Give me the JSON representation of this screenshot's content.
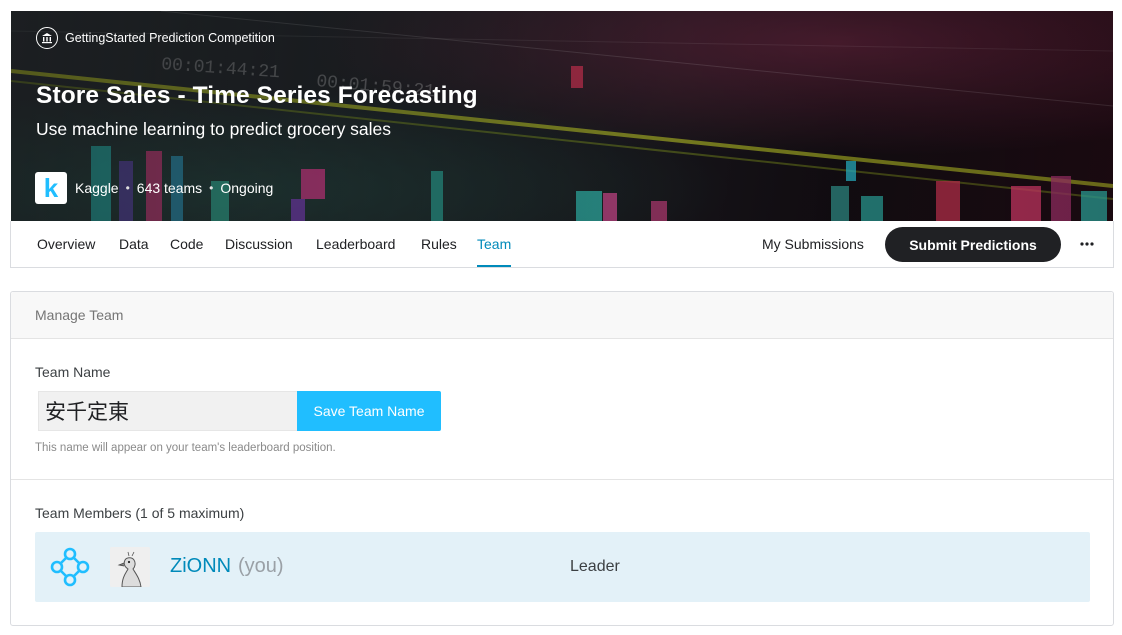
{
  "hero": {
    "badge": "GettingStarted Prediction Competition",
    "badge_icon": "institution-icon",
    "title": "Store Sales - Time Series Forecasting",
    "subtitle": "Use machine learning to predict grocery sales",
    "host": "Kaggle",
    "teams": "643 teams",
    "status": "Ongoing",
    "logo_letter": "k",
    "accent_color": "#20beff"
  },
  "nav": {
    "tabs": [
      {
        "label": "Overview"
      },
      {
        "label": "Data"
      },
      {
        "label": "Code"
      },
      {
        "label": "Discussion"
      },
      {
        "label": "Leaderboard"
      },
      {
        "label": "Rules"
      },
      {
        "label": "Team",
        "active": true
      }
    ],
    "my_submissions": "My Submissions",
    "submit_predictions": "Submit Predictions",
    "more_icon": "more-horizontal-icon"
  },
  "manage_team": {
    "header": "Manage Team",
    "team_name_label": "Team Name",
    "team_name_value": "安千定東",
    "save_button": "Save Team Name",
    "helper_text": "This name will appear on your team's leaderboard position.",
    "members_label": "Team Members (1 of 5 maximum)",
    "members": [
      {
        "name": "ZiONN",
        "you_tag": "(you)",
        "role": "Leader",
        "tier_icon": "contributor-tier-icon"
      }
    ]
  },
  "colors": {
    "link": "#008aba",
    "primary_button": "#20beff",
    "dark_button": "#202124",
    "member_row_bg": "#e3f1f8"
  }
}
